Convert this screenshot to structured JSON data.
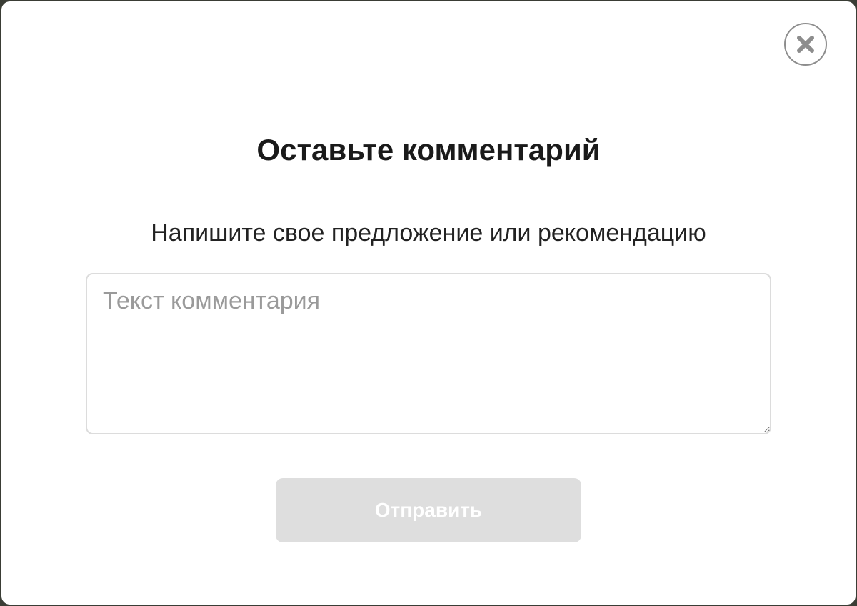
{
  "modal": {
    "title": "Оставьте комментарий",
    "subtitle": "Напишите свое предложение или рекомендацию",
    "close_icon": "close-x-icon",
    "comment": {
      "value": "",
      "placeholder": "Текст комментария"
    },
    "submit_label": "Отправить",
    "submit_disabled": true
  },
  "colors": {
    "background": "#ffffff",
    "title": "#1a1a1a",
    "placeholder": "#9a9a9a",
    "input_border": "#dcdcdc",
    "button_disabled_bg": "#dedede",
    "button_text": "#ffffff",
    "close_icon": "#8d8d8d"
  }
}
